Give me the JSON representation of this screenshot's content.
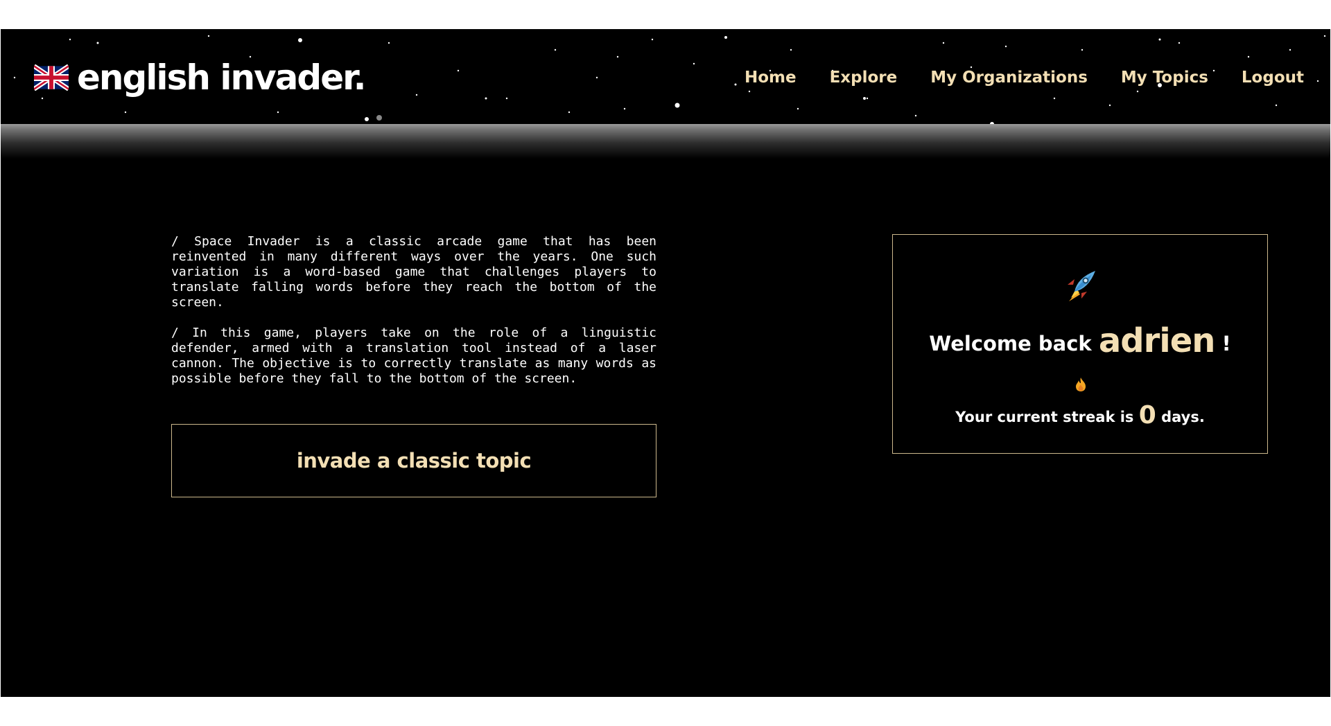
{
  "brand": {
    "name": "english invader."
  },
  "nav": {
    "items": [
      {
        "label": "Home"
      },
      {
        "label": "Explore"
      },
      {
        "label": "My Organizations"
      },
      {
        "label": "My Topics"
      },
      {
        "label": "Logout"
      }
    ]
  },
  "intro": {
    "paragraphs": [
      "/ Space Invader is a classic arcade game that has been reinvented in many different ways over the years. One such variation is a word-based game that challenges players to translate falling words before they reach the bottom of the screen.",
      "/ In this game, players take on the role of a linguistic defender, armed with a translation tool instead of a laser cannon. The objective is to correctly translate as many words as possible before they fall to the bottom of the screen."
    ]
  },
  "cta": {
    "label": "invade a classic topic"
  },
  "welcome": {
    "prefix": "Welcome back ",
    "username": "adrien",
    "suffix": " !",
    "streak_prefix": "Your current streak is ",
    "streak_days": "0",
    "streak_suffix": " days."
  },
  "icons": {
    "flag": "uk-flag-icon",
    "rocket": "rocket-icon",
    "flame": "fire-icon"
  },
  "colors": {
    "background": "#000000",
    "accent": "#f3dfb4",
    "border": "#cdb98d",
    "text": "#ffffff"
  }
}
